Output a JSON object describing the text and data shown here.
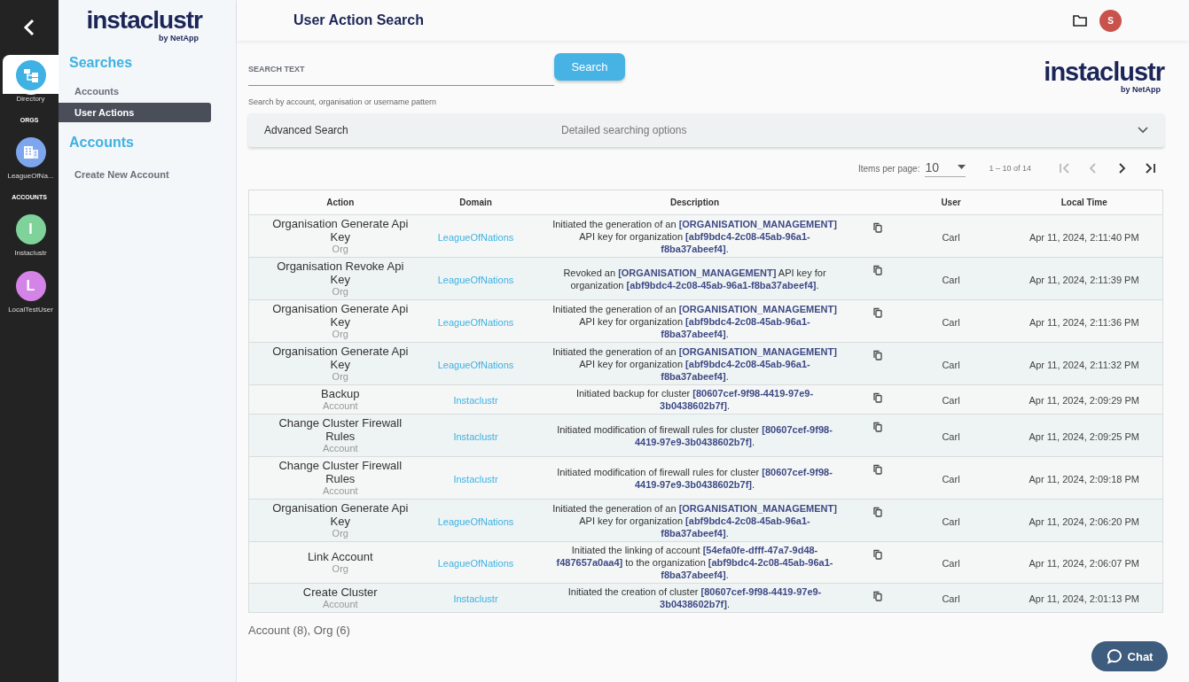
{
  "rail": {
    "items": [
      {
        "kind": "directory",
        "label": "Directory",
        "selected": true,
        "color": "#3fb1e3"
      },
      {
        "kind": "section",
        "label": "ORGS"
      },
      {
        "kind": "org",
        "label": "LeagueOfNa...",
        "selected": false,
        "color": "#7ea6ee"
      },
      {
        "kind": "section",
        "label": "ACCOUNTS"
      },
      {
        "kind": "account",
        "initial": "I",
        "label": "Instaclustr",
        "selected": false,
        "color": "#7fd39a"
      },
      {
        "kind": "account",
        "initial": "L",
        "label": "LocalTestUser",
        "selected": false,
        "color": "#d483e6"
      }
    ]
  },
  "logo": {
    "name": "instaclustr",
    "tagline": "by NetApp"
  },
  "nav": [
    {
      "heading": "Searches",
      "items": [
        {
          "label": "Accounts",
          "selected": false
        },
        {
          "label": "User Actions",
          "selected": true
        }
      ]
    },
    {
      "heading": "Accounts",
      "items": [
        {
          "label": "Create New Account",
          "selected": false
        }
      ]
    }
  ],
  "header": {
    "title": "User Action Search",
    "avatar": "S",
    "logo_name": "instaclustr",
    "logo_tagline": "by NetApp"
  },
  "search": {
    "label": "SEARCH TEXT",
    "hint": "Search by account, organisation or username pattern",
    "button": "Search"
  },
  "advanced": {
    "title": "Advanced Search",
    "description": "Detailed searching options",
    "expanded": false
  },
  "pager": {
    "label": "Items per page:",
    "page_size": "10",
    "range": "1 – 10 of 14",
    "buttons": [
      {
        "kind": "first",
        "disabled": true
      },
      {
        "kind": "prev",
        "disabled": true
      },
      {
        "kind": "next",
        "disabled": false
      },
      {
        "kind": "last",
        "disabled": false
      }
    ]
  },
  "table": {
    "columns": [
      "Action",
      "Domain",
      "Description",
      "User",
      "Local Time"
    ],
    "rows": [
      {
        "action": "Organisation Generate Api Key",
        "type": "Org",
        "domain": "LeagueOfNations",
        "description": "Initiated the generation of an **[ORGANISATION_MANAGEMENT]** API key for organization **[abf9bdc4-2c08-45ab-96a1-f8ba37abeef4]**.",
        "user": "Carl",
        "time": "Apr 11, 2024, 2:11:40 PM"
      },
      {
        "action": "Organisation Revoke Api Key",
        "type": "Org",
        "domain": "LeagueOfNations",
        "description": "Revoked an **[ORGANISATION_MANAGEMENT]** API key for organization **[abf9bdc4-2c08-45ab-96a1-f8ba37abeef4]**.",
        "user": "Carl",
        "time": "Apr 11, 2024, 2:11:39 PM"
      },
      {
        "action": "Organisation Generate Api Key",
        "type": "Org",
        "domain": "LeagueOfNations",
        "description": "Initiated the generation of an **[ORGANISATION_MANAGEMENT]** API key for organization **[abf9bdc4-2c08-45ab-96a1-f8ba37abeef4]**.",
        "user": "Carl",
        "time": "Apr 11, 2024, 2:11:36 PM"
      },
      {
        "action": "Organisation Generate Api Key",
        "type": "Org",
        "domain": "LeagueOfNations",
        "description": "Initiated the generation of an **[ORGANISATION_MANAGEMENT]** API key for organization **[abf9bdc4-2c08-45ab-96a1-f8ba37abeef4]**.",
        "user": "Carl",
        "time": "Apr 11, 2024, 2:11:32 PM"
      },
      {
        "action": "Backup",
        "type": "Account",
        "domain": "Instaclustr",
        "description": "Initiated backup for cluster **[80607cef-9f98-4419-97e9-3b0438602b7f]**.",
        "user": "Carl",
        "time": "Apr 11, 2024, 2:09:29 PM"
      },
      {
        "action": "Change Cluster Firewall Rules",
        "type": "Account",
        "domain": "Instaclustr",
        "description": "Initiated modification of firewall rules for cluster **[80607cef-9f98-4419-97e9-3b0438602b7f]**.",
        "user": "Carl",
        "time": "Apr 11, 2024, 2:09:25 PM"
      },
      {
        "action": "Change Cluster Firewall Rules",
        "type": "Account",
        "domain": "Instaclustr",
        "description": "Initiated modification of firewall rules for cluster **[80607cef-9f98-4419-97e9-3b0438602b7f]**.",
        "user": "Carl",
        "time": "Apr 11, 2024, 2:09:18 PM"
      },
      {
        "action": "Organisation Generate Api Key",
        "type": "Org",
        "domain": "LeagueOfNations",
        "description": "Initiated the generation of an **[ORGANISATION_MANAGEMENT]** API key for organization **[abf9bdc4-2c08-45ab-96a1-f8ba37abeef4]**.",
        "user": "Carl",
        "time": "Apr 11, 2024, 2:06:20 PM"
      },
      {
        "action": "Link Account",
        "type": "Org",
        "domain": "LeagueOfNations",
        "description": "Initiated the linking of account **[54efa0fe-dfff-47a7-9d48-f487657a0aa4]** to the organization **[abf9bdc4-2c08-45ab-96a1-f8ba37abeef4]**.",
        "user": "Carl",
        "time": "Apr 11, 2024, 2:06:07 PM"
      },
      {
        "action": "Create Cluster",
        "type": "Account",
        "domain": "Instaclustr",
        "description": "Initiated the creation of cluster **[80607cef-9f98-4419-97e9-3b0438602b7f]**.",
        "user": "Carl",
        "time": "Apr 11, 2024, 2:01:13 PM"
      }
    ]
  },
  "summary": "Account (8), Org (6)",
  "chat": {
    "label": "Chat"
  }
}
